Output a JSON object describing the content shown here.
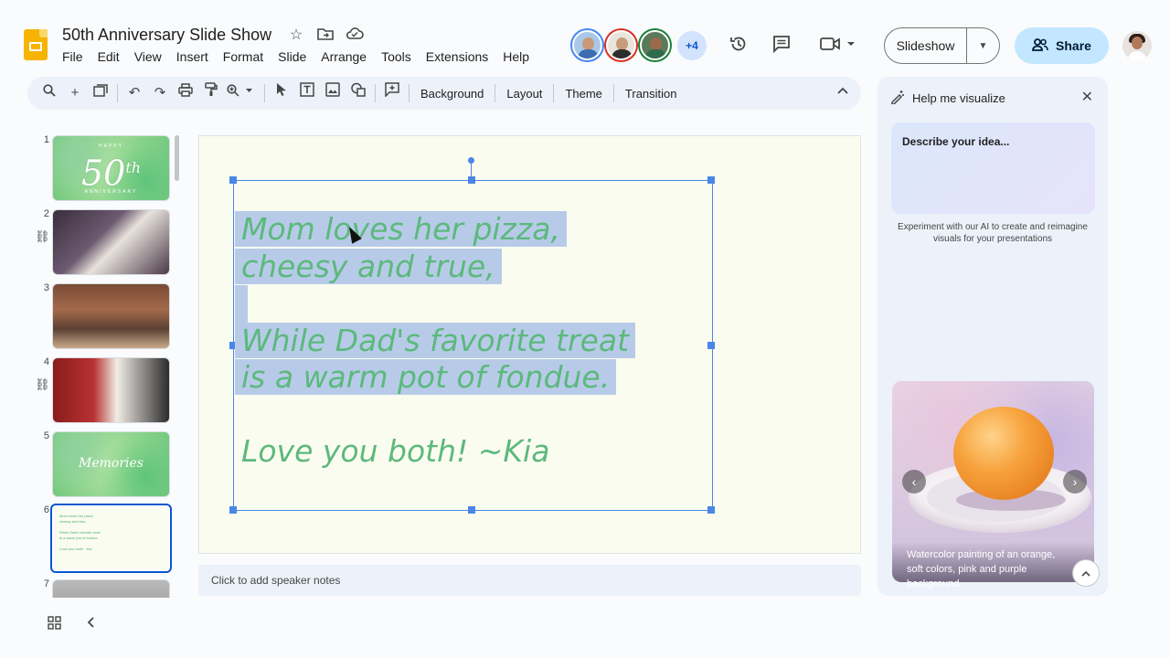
{
  "app": {
    "title": "50th Anniversary Slide Show",
    "menus": [
      "File",
      "Edit",
      "View",
      "Insert",
      "Format",
      "Slide",
      "Arrange",
      "Tools",
      "Extensions",
      "Help"
    ]
  },
  "header": {
    "collaborators_more": "+4",
    "slideshow_label": "Slideshow",
    "share_label": "Share"
  },
  "toolbar": {
    "background_label": "Background",
    "layout_label": "Layout",
    "theme_label": "Theme",
    "transition_label": "Transition"
  },
  "slides": [
    {
      "num": "1",
      "big": "50",
      "sup": "th",
      "top": "HAPPY",
      "bottom": "ANNIVERSARY"
    },
    {
      "num": "2"
    },
    {
      "num": "3"
    },
    {
      "num": "4"
    },
    {
      "num": "5",
      "caption": "Memories"
    },
    {
      "num": "6"
    },
    {
      "num": "7"
    }
  ],
  "slide6_thumb_lines": [
    "Mom loves her pizza",
    "cheesy and true,",
    "",
    "While Dad's favorite treat",
    "is a warm pot of fondue.",
    "",
    "Love you both! ~Kia"
  ],
  "slide": {
    "line1": "Mom loves her pizza,",
    "line2": "cheesy and true,",
    "line3": "While Dad's favorite treat",
    "line4": "is a warm pot of fondue.",
    "line5": "Love you both! ~Kia"
  },
  "notes": {
    "placeholder": "Click to add speaker notes"
  },
  "panel": {
    "title": "Help me visualize",
    "idea_placeholder": "Describe your idea...",
    "experiment_text": "Experiment with our AI to create and reimagine visuals for your presentations",
    "image_caption": "Watercolor painting of an orange, soft colors, pink and purple background."
  },
  "colors": {
    "accent": "#0b57d0",
    "share_bg": "#c2e7ff",
    "text_green": "#5cb97c",
    "highlight": "#b7cbe9",
    "selection": "#4a86e8"
  }
}
